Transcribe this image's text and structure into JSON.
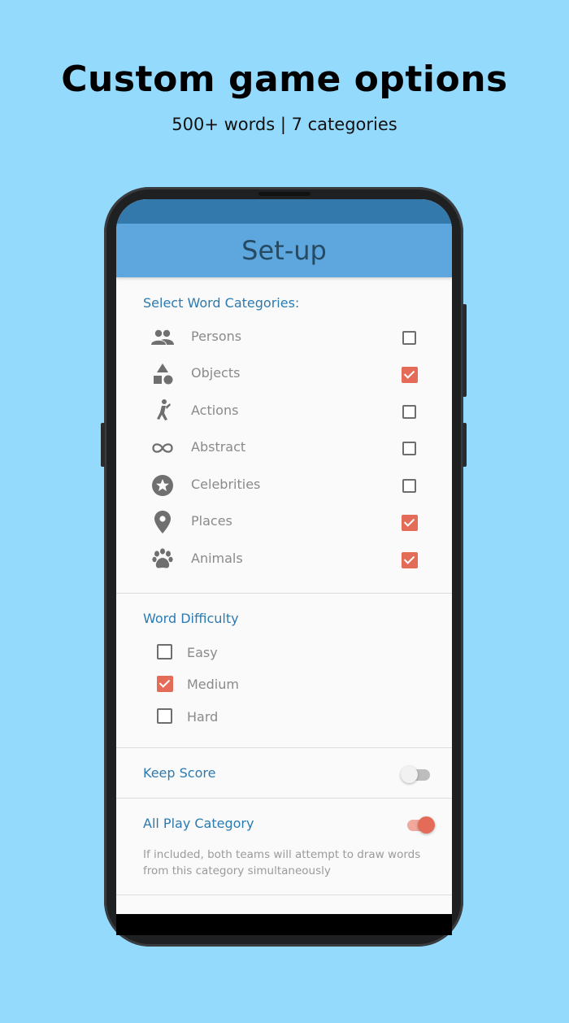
{
  "headline": "Custom game options",
  "subheadline": "500+ words | 7 categories",
  "app": {
    "title": "Set-up",
    "accent_color": "#5da6de",
    "check_color": "#e46b57"
  },
  "categories": {
    "title": "Select Word Categories:",
    "items": [
      {
        "label": "Persons",
        "icon": "people-icon",
        "checked": false
      },
      {
        "label": "Objects",
        "icon": "shapes-icon",
        "checked": true
      },
      {
        "label": "Actions",
        "icon": "running-person-icon",
        "checked": false
      },
      {
        "label": "Abstract",
        "icon": "infinity-icon",
        "checked": false
      },
      {
        "label": "Celebrities",
        "icon": "star-badge-icon",
        "checked": false
      },
      {
        "label": "Places",
        "icon": "map-pin-icon",
        "checked": true
      },
      {
        "label": "Animals",
        "icon": "paw-icon",
        "checked": true
      }
    ]
  },
  "difficulty": {
    "title": "Word Difficulty",
    "options": [
      {
        "label": "Easy",
        "checked": false
      },
      {
        "label": "Medium",
        "checked": true
      },
      {
        "label": "Hard",
        "checked": false
      }
    ]
  },
  "keep_score": {
    "label": "Keep Score",
    "on": false
  },
  "all_play": {
    "label": "All Play Category",
    "on": true,
    "helper": "If included, both teams will attempt to draw words from this category simultaneously"
  }
}
